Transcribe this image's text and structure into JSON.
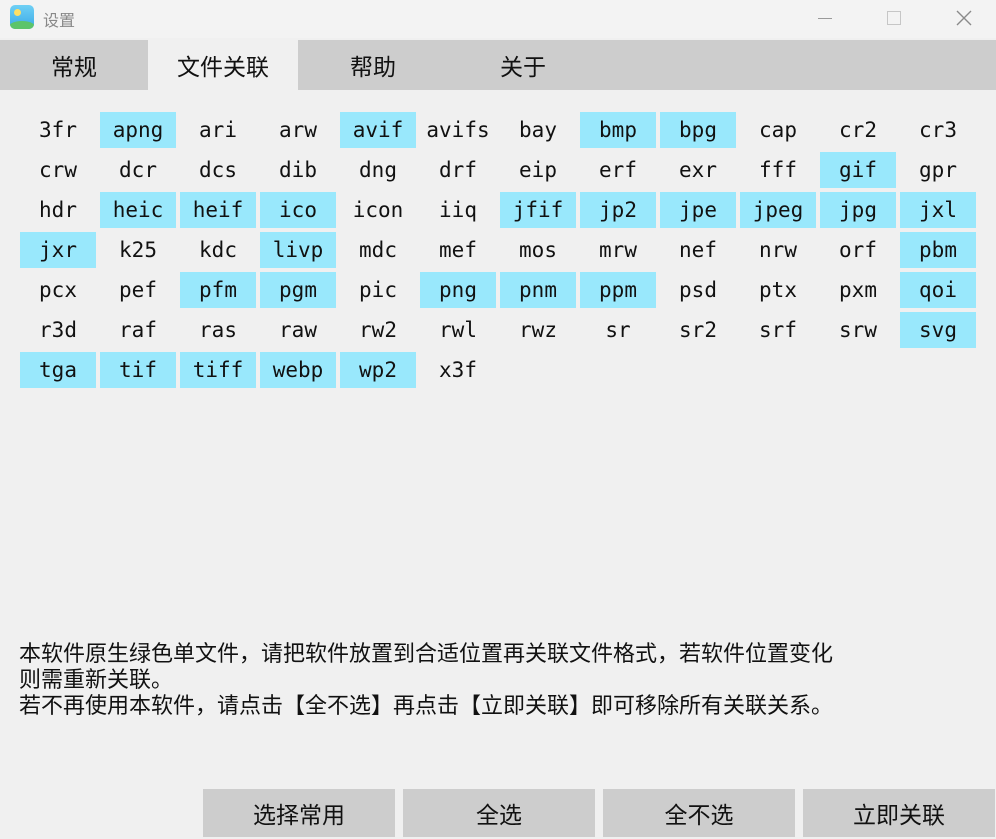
{
  "window": {
    "title": "设置",
    "icon": "image-viewer-app-icon",
    "controls": {
      "minimize": "minimize-icon",
      "maximize": "maximize-icon",
      "close": "close-icon"
    }
  },
  "tabs": [
    {
      "label": "常规",
      "active": false
    },
    {
      "label": "文件关联",
      "active": true
    },
    {
      "label": "帮助",
      "active": false
    },
    {
      "label": "关于",
      "active": false
    }
  ],
  "formats": [
    {
      "ext": "3fr",
      "selected": false
    },
    {
      "ext": "apng",
      "selected": true
    },
    {
      "ext": "ari",
      "selected": false
    },
    {
      "ext": "arw",
      "selected": false
    },
    {
      "ext": "avif",
      "selected": true
    },
    {
      "ext": "avifs",
      "selected": false
    },
    {
      "ext": "bay",
      "selected": false
    },
    {
      "ext": "bmp",
      "selected": true
    },
    {
      "ext": "bpg",
      "selected": true
    },
    {
      "ext": "cap",
      "selected": false
    },
    {
      "ext": "cr2",
      "selected": false
    },
    {
      "ext": "cr3",
      "selected": false
    },
    {
      "ext": "crw",
      "selected": false
    },
    {
      "ext": "dcr",
      "selected": false
    },
    {
      "ext": "dcs",
      "selected": false
    },
    {
      "ext": "dib",
      "selected": false
    },
    {
      "ext": "dng",
      "selected": false
    },
    {
      "ext": "drf",
      "selected": false
    },
    {
      "ext": "eip",
      "selected": false
    },
    {
      "ext": "erf",
      "selected": false
    },
    {
      "ext": "exr",
      "selected": false
    },
    {
      "ext": "fff",
      "selected": false
    },
    {
      "ext": "gif",
      "selected": true
    },
    {
      "ext": "gpr",
      "selected": false
    },
    {
      "ext": "hdr",
      "selected": false
    },
    {
      "ext": "heic",
      "selected": true
    },
    {
      "ext": "heif",
      "selected": true
    },
    {
      "ext": "ico",
      "selected": true
    },
    {
      "ext": "icon",
      "selected": false
    },
    {
      "ext": "iiq",
      "selected": false
    },
    {
      "ext": "jfif",
      "selected": true
    },
    {
      "ext": "jp2",
      "selected": true
    },
    {
      "ext": "jpe",
      "selected": true
    },
    {
      "ext": "jpeg",
      "selected": true
    },
    {
      "ext": "jpg",
      "selected": true
    },
    {
      "ext": "jxl",
      "selected": true
    },
    {
      "ext": "jxr",
      "selected": true
    },
    {
      "ext": "k25",
      "selected": false
    },
    {
      "ext": "kdc",
      "selected": false
    },
    {
      "ext": "livp",
      "selected": true
    },
    {
      "ext": "mdc",
      "selected": false
    },
    {
      "ext": "mef",
      "selected": false
    },
    {
      "ext": "mos",
      "selected": false
    },
    {
      "ext": "mrw",
      "selected": false
    },
    {
      "ext": "nef",
      "selected": false
    },
    {
      "ext": "nrw",
      "selected": false
    },
    {
      "ext": "orf",
      "selected": false
    },
    {
      "ext": "pbm",
      "selected": true
    },
    {
      "ext": "pcx",
      "selected": false
    },
    {
      "ext": "pef",
      "selected": false
    },
    {
      "ext": "pfm",
      "selected": true
    },
    {
      "ext": "pgm",
      "selected": true
    },
    {
      "ext": "pic",
      "selected": false
    },
    {
      "ext": "png",
      "selected": true
    },
    {
      "ext": "pnm",
      "selected": true
    },
    {
      "ext": "ppm",
      "selected": true
    },
    {
      "ext": "psd",
      "selected": false
    },
    {
      "ext": "ptx",
      "selected": false
    },
    {
      "ext": "pxm",
      "selected": false
    },
    {
      "ext": "qoi",
      "selected": true
    },
    {
      "ext": "r3d",
      "selected": false
    },
    {
      "ext": "raf",
      "selected": false
    },
    {
      "ext": "ras",
      "selected": false
    },
    {
      "ext": "raw",
      "selected": false
    },
    {
      "ext": "rw2",
      "selected": false
    },
    {
      "ext": "rwl",
      "selected": false
    },
    {
      "ext": "rwz",
      "selected": false
    },
    {
      "ext": "sr",
      "selected": false
    },
    {
      "ext": "sr2",
      "selected": false
    },
    {
      "ext": "srf",
      "selected": false
    },
    {
      "ext": "srw",
      "selected": false
    },
    {
      "ext": "svg",
      "selected": true
    },
    {
      "ext": "tga",
      "selected": true
    },
    {
      "ext": "tif",
      "selected": true
    },
    {
      "ext": "tiff",
      "selected": true
    },
    {
      "ext": "webp",
      "selected": true
    },
    {
      "ext": "wp2",
      "selected": true
    },
    {
      "ext": "x3f",
      "selected": false
    }
  ],
  "colors": {
    "selected_bg": "#99e8fc",
    "tabbar_bg": "#cdcdcd",
    "window_bg": "#f0f0f0"
  },
  "notice": {
    "line1": "本软件原生绿色单文件，请把软件放置到合适位置再关联文件格式，若软件位置变化",
    "line2": "则需重新关联。",
    "line3": "若不再使用本软件，请点击【全不选】再点击【立即关联】即可移除所有关联关系。"
  },
  "buttons": {
    "select_common": "选择常用",
    "select_all": "全选",
    "select_none": "全不选",
    "associate_now": "立即关联"
  }
}
